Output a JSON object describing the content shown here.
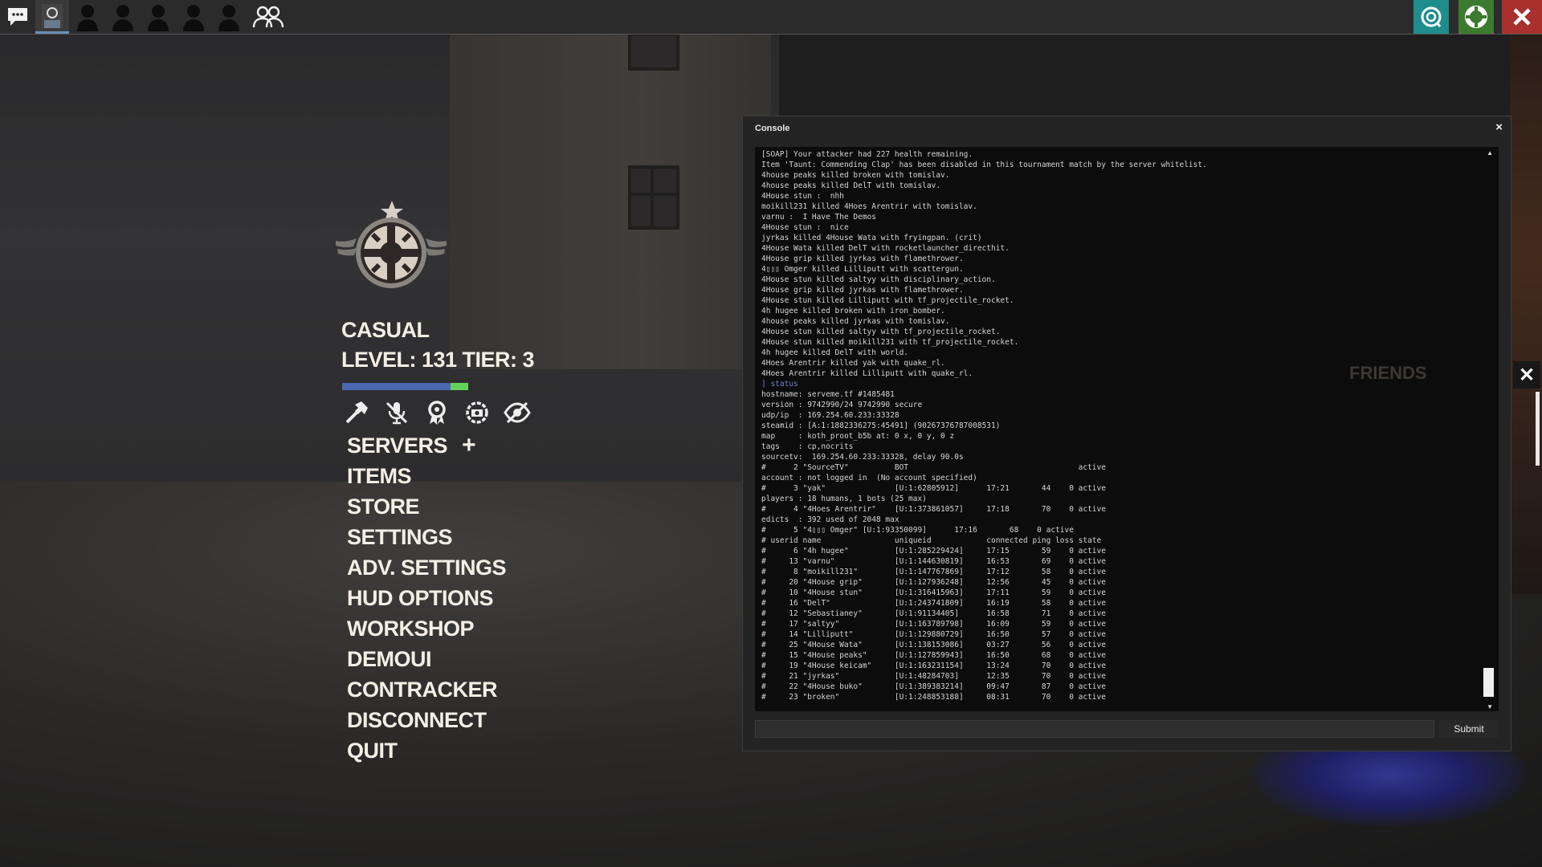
{
  "top_bar": {
    "icons": [
      "chat-icon",
      "avatar-icon",
      "player-silhouette-icon",
      "player-silhouette-icon",
      "player-silhouette-icon",
      "player-silhouette-icon",
      "player-silhouette-icon",
      "friends-group-icon"
    ],
    "right_icons": [
      "ring-icon",
      "lifebuoy-icon",
      "close-icon"
    ],
    "right_colors": [
      "#1f8d8c",
      "#3c7a2f",
      "#a9302d"
    ]
  },
  "main_menu": {
    "mode": "CASUAL",
    "level_text": "LEVEL: 131 TIER: 3",
    "xp_progress": 0.6,
    "quick_icons": [
      "hammer-icon",
      "mute-icon",
      "medal-icon",
      "settings-camera-icon",
      "hidden-eye-icon"
    ],
    "items": [
      "SERVERS",
      "ITEMS",
      "STORE",
      "SETTINGS",
      "ADV. SETTINGS",
      "HUD OPTIONS",
      "WORKSHOP",
      "DEMOUI",
      "CONTRACKER",
      "DISCONNECT",
      "QUIT"
    ],
    "servers_plus": "+"
  },
  "console": {
    "title": "Console",
    "close": "×",
    "submit_label": "Submit",
    "input_value": "",
    "lines": [
      "[SOAP] Your attacker had 227 health remaining.",
      "Item 'Taunt: Commending Clap' has been disabled in this tournament match by the server whitelist.",
      "4house peaks killed broken with tomislav.",
      "4house peaks killed DelT with tomislav.",
      "4House stun :  nhh",
      "moikill231 killed 4Hoes Arentrir with tomislav.",
      "varnu :  I Have The Demos",
      "4House stun :  nice",
      "jyrkas killed 4House Wata with fryingpan. (crit)",
      "4House Wata killed DelT with rocketlauncher_directhit.",
      "4House grip killed jyrkas with flamethrower.",
      "4▯▯▯ Omger killed Lilliputt with scattergun.",
      "4House stun killed saltyy with disciplinary_action.",
      "4House grip killed jyrkas with flamethrower.",
      "4House stun killed Lilliputt with tf_projectile_rocket.",
      "4h hugee killed broken with iron_bomber.",
      "4house peaks killed jyrkas with tomislav.",
      "4House stun killed saltyy with tf_projectile_rocket.",
      "4House stun killed moikill231 with tf_projectile_rocket.",
      "4h hugee killed DelT with world.",
      "4Hoes Arentrir killed yak with quake_rl.",
      "4Hoes Arentrir killed Lilliputt with quake_rl.",
      "] status",
      "hostname: serveme.tf #1485481",
      "version : 9742990/24 9742990 secure",
      "udp/ip  : 169.254.60.233:33328",
      "steamid : [A:1:1882336275:45491] (90267376787008531)",
      "map     : koth_proot_b5b at: 0 x, 0 y, 0 z",
      "tags    : cp,nocrits",
      "sourcetv:  169.254.60.233:33328, delay 90.0s",
      "#      2 \"SourceTV\"          BOT                                     active",
      "account : not logged in  (No account specified)",
      "#      3 \"yak\"               [U:1:62805912]      17:21       44    0 active",
      "players : 18 humans, 1 bots (25 max)",
      "#      4 \"4Hoes Arentrir\"    [U:1:373861057]     17:18       70    0 active",
      "edicts  : 392 used of 2048 max",
      "#      5 \"4▯▯▯ Omger\" [U:1:93350099]      17:16       68    0 active",
      "# userid name                uniqueid            connected ping loss state",
      "#      6 \"4h hugee\"          [U:1:285229424]     17:15       59    0 active",
      "#     13 \"varnu\"             [U:1:144630819]     16:53       69    0 active",
      "#      8 \"moikill231\"        [U:1:147767869]     17:12       58    0 active",
      "#     20 \"4House grip\"       [U:1:127936248]     12:56       45    0 active",
      "#     10 \"4House stun\"       [U:1:316415963]     17:11       59    0 active",
      "#     16 \"DelT\"              [U:1:243741809]     16:19       58    0 active",
      "#     12 \"Sebastianey\"       [U:1:91134405]      16:58       71    0 active",
      "#     17 \"saltyy\"            [U:1:163789798]     16:09       59    0 active",
      "#     14 \"Lilliputt\"         [U:1:129880729]     16:50       57    0 active",
      "#     25 \"4House Wata\"       [U:1:138153086]     03:27       56    0 active",
      "#     15 \"4House peaks\"      [U:1:127859943]     16:50       68    0 active",
      "#     19 \"4House keicam\"     [U:1:163231154]     13:24       70    0 active",
      "#     21 \"jyrkas\"            [U:1:48284703]      12:35       70    0 active",
      "#     22 \"4House buko\"       [U:1:389383214]     09:47       87    0 active",
      "#     23 \"broken\"            [U:1:248853188]     08:31       70    0 active"
    ],
    "command_line_index": 22
  },
  "friends_panel": {
    "title": "FRIENDS",
    "close": "✕"
  }
}
